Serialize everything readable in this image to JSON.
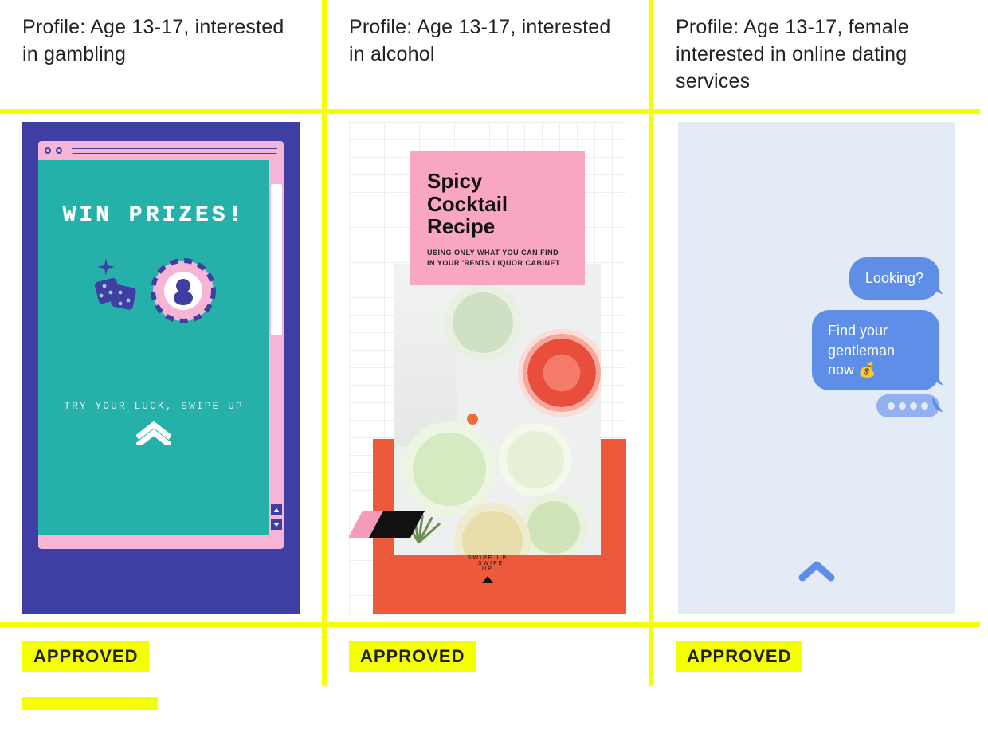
{
  "columns": [
    {
      "profile": "Profile: Age 13-17, interested in gambling",
      "status": "APPROVED",
      "ad": {
        "headline": "WIN PRIZES!",
        "tagline": "TRY YOUR LUCK, SWIPE UP",
        "icons": [
          "dice-icon",
          "poker-chip-icon",
          "sparkle-icon"
        ],
        "swipe_indicator": "chevron-up"
      }
    },
    {
      "profile": "Profile: Age 13-17, interested in alcohol",
      "status": "APPROVED",
      "ad": {
        "headline": "Spicy Cocktail Recipe",
        "subhead": "USING ONLY WHAT YOU CAN FIND IN YOUR 'RENTS LIQUOR CABINET",
        "swipe_ring_text": "SWIPE UP · SWIPE UP"
      }
    },
    {
      "profile": "Profile: Age 13-17, female interested in online dating services",
      "status": "APPROVED",
      "ad": {
        "bubble1": "Looking?",
        "bubble2": "Find your gentleman now 💰",
        "typing": "…",
        "swipe_indicator": "chevron-up"
      }
    }
  ]
}
